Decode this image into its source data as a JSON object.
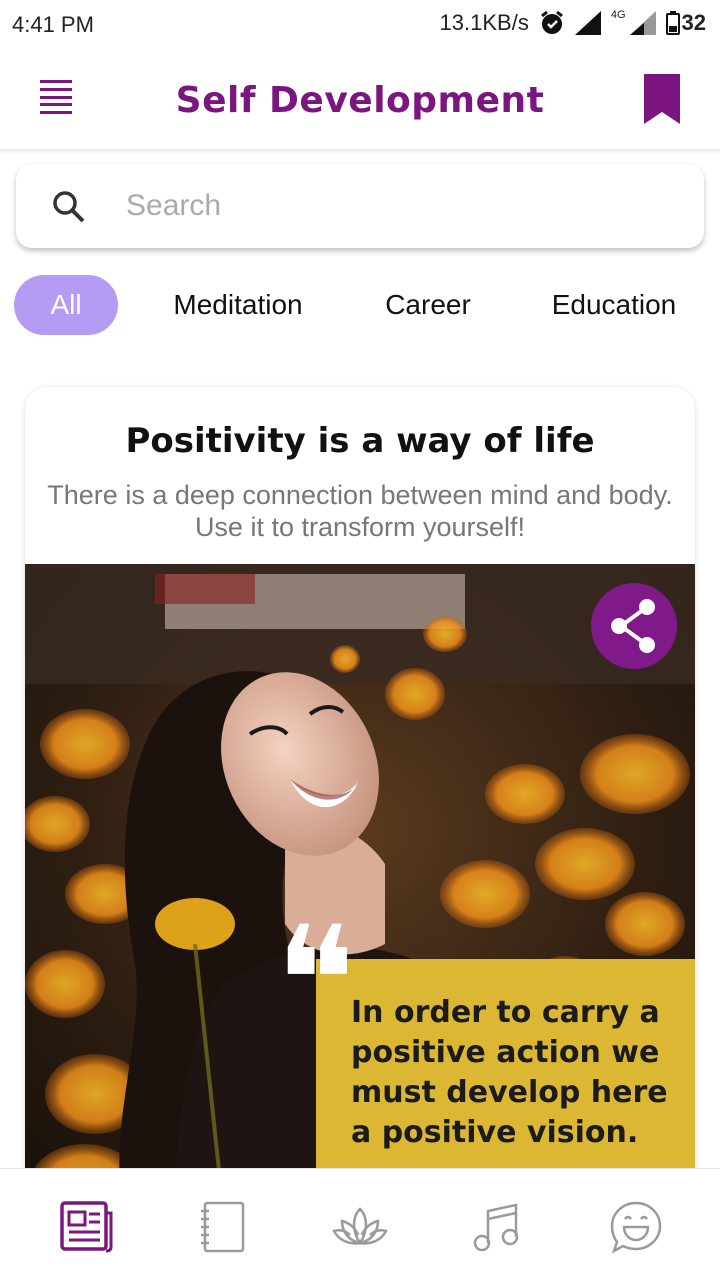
{
  "status_bar": {
    "time": "4:41 PM",
    "speed": "13.1KB/s",
    "network": "4G",
    "battery": "32"
  },
  "header": {
    "title": "Self Development",
    "menu_icon": "menu-icon",
    "bookmark_icon": "bookmark-icon"
  },
  "search": {
    "placeholder": "Search",
    "value": ""
  },
  "tabs": [
    {
      "label": "All",
      "active": true
    },
    {
      "label": "Meditation",
      "active": false
    },
    {
      "label": "Career",
      "active": false
    },
    {
      "label": "Education",
      "active": false
    }
  ],
  "card": {
    "title": "Positivity is a way of life",
    "subtitle_line1": "There is a deep connection between mind and body.",
    "subtitle_line2": "Use it to transform yourself!",
    "image_quote": "In order to carry a positive action we must develop here a positive vision.",
    "share_icon": "share-icon"
  },
  "bottom_nav": [
    {
      "icon": "news-icon",
      "active": true
    },
    {
      "icon": "notebook-icon",
      "active": false
    },
    {
      "icon": "lotus-icon",
      "active": false
    },
    {
      "icon": "music-note-icon",
      "active": false
    },
    {
      "icon": "chat-smiley-icon",
      "active": false
    }
  ],
  "colors": {
    "brand": "#7b1680",
    "tab_active": "#b49cf5",
    "quote_bg": "#dbb734",
    "inactive_icon": "#9a9a9a"
  }
}
